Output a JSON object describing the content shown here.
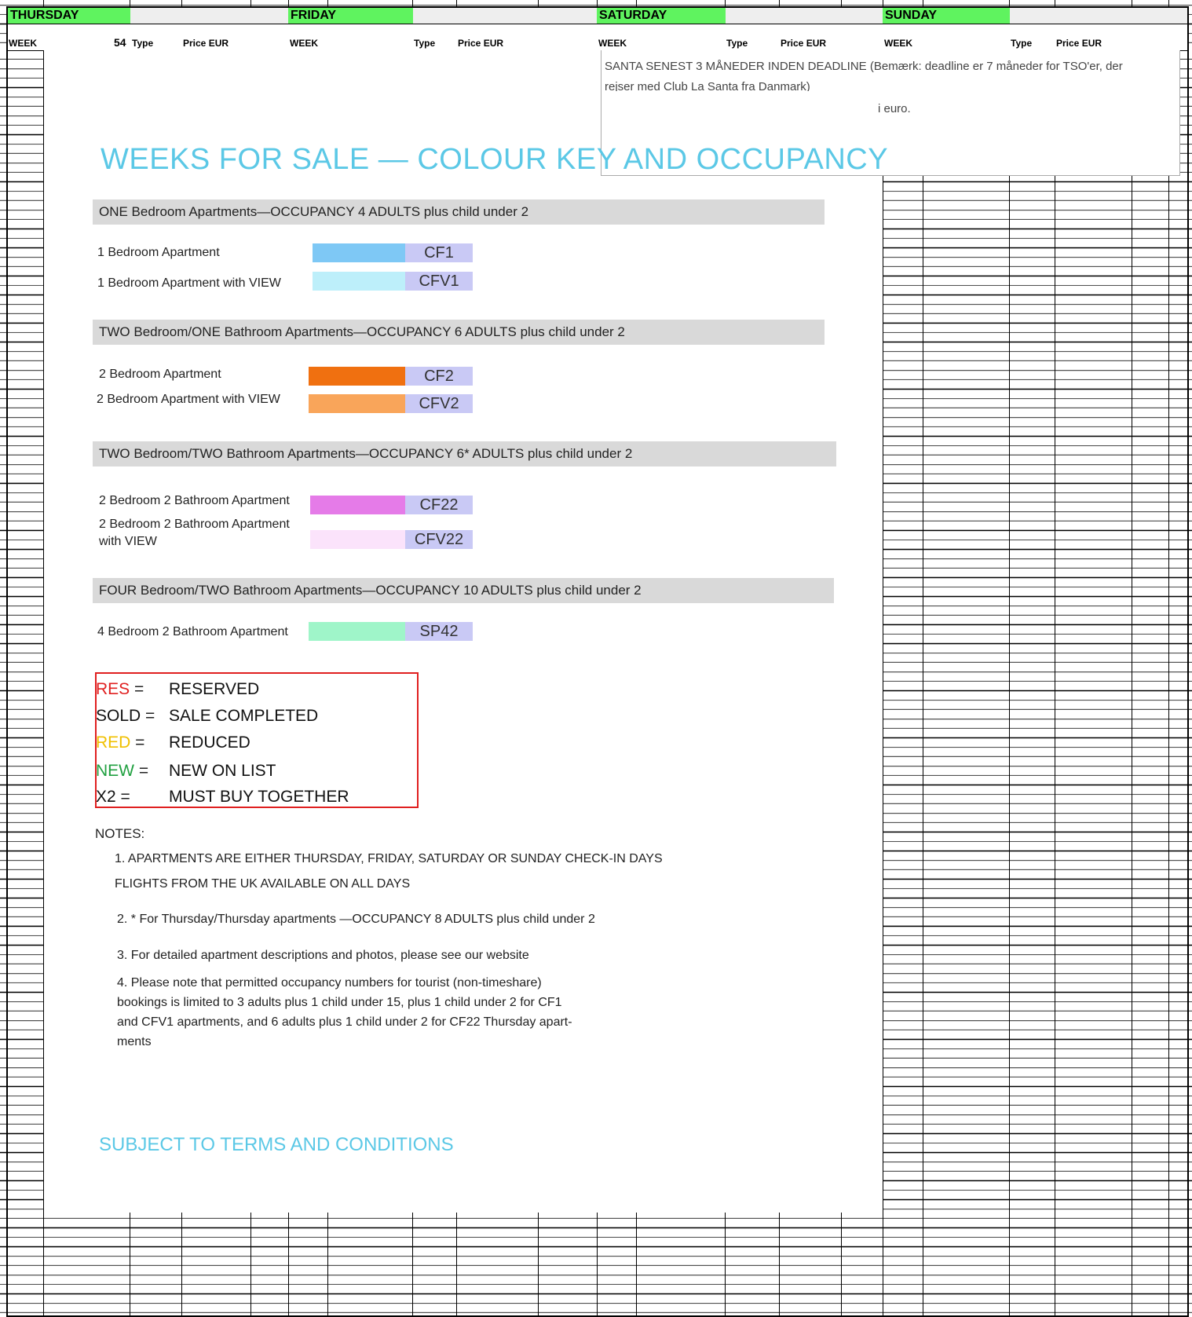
{
  "days": [
    {
      "label": "THURSDAY"
    },
    {
      "label": "FRIDAY"
    },
    {
      "label": "SATURDAY"
    },
    {
      "label": "SUNDAY"
    }
  ],
  "columns": {
    "week": "WEEK",
    "type": "Type",
    "price": "Price EUR",
    "week_no": "54"
  },
  "note_overlay": {
    "line1": "SANTA SENEST 3 MÅNEDER INDEN DEADLINE (Bemærk: deadline er 7 måneder for TSO'er, der",
    "line2": "rejser med Club La Santa fra Danmark)",
    "line3": "i euro."
  },
  "title": "WEEKS FOR SALE — COLOUR KEY AND OCCUPANCY",
  "sections": [
    {
      "heading": "ONE Bedroom Apartments—OCCUPANCY 4 ADULTS plus child under 2",
      "rows": [
        {
          "label": "1 Bedroom Apartment",
          "code": "CF1",
          "color": "#7ec8f5"
        },
        {
          "label": "1 Bedroom Apartment with VIEW",
          "code": "CFV1",
          "color": "#bdeffa"
        }
      ]
    },
    {
      "heading": "TWO Bedroom/ONE Bathroom  Apartments—OCCUPANCY 6 ADULTS plus child under 2",
      "rows": [
        {
          "label": "2 Bedroom Apartment",
          "code": "CF2",
          "color": "#f07010"
        },
        {
          "label": "2 Bedroom Apartment with VIEW",
          "code": "CFV2",
          "color": "#f9a55a"
        }
      ]
    },
    {
      "heading": "TWO Bedroom/TWO Bathroom Apartments—OCCUPANCY 6* ADULTS plus child under 2",
      "rows": [
        {
          "label": "2 Bedroom 2 Bathroom Apartment",
          "code": "CF22",
          "color": "#e57be8"
        },
        {
          "label": "2 Bedroom 2 Bathroom Apartment with VIEW",
          "label_line1": "2 Bedroom 2 Bathroom Apartment",
          "label_line2": "with VIEW",
          "code": "CFV22",
          "color": "#fbe3fb"
        }
      ]
    },
    {
      "heading": "FOUR Bedroom/TWO Bathroom Apartments—OCCUPANCY 10 ADULTS plus child under 2",
      "rows": [
        {
          "label": "4 Bedroom 2 Bathroom Apartment",
          "code": "SP42",
          "color": "#9ff5c9"
        }
      ]
    }
  ],
  "legend": [
    {
      "key": "RES",
      "sep": " =",
      "value": "RESERVED",
      "key_color": "#e02020"
    },
    {
      "key": "SOLD",
      "sep": " =",
      "value": "SALE COMPLETED",
      "key_color": "#111111"
    },
    {
      "key": "RED",
      "sep": " =",
      "value": "REDUCED",
      "key_color": "#f0c000"
    },
    {
      "key": "NEW",
      "sep": " =",
      "value": "NEW ON LIST",
      "key_color": "#20a040"
    },
    {
      "key": "X2",
      "sep": " =",
      "value": "MUST BUY TOGETHER",
      "key_color": "#111111"
    }
  ],
  "notes_heading": "NOTES:",
  "notes": {
    "n1a": "1. APARTMENTS ARE EITHER THURSDAY, FRIDAY, SATURDAY OR SUNDAY CHECK-IN DAYS",
    "n1b": "FLIGHTS FROM THE UK AVAILABLE ON ALL DAYS",
    "n2": "2. * For Thursday/Thursday apartments —OCCUPANCY 8 ADULTS plus child under 2",
    "n3": "3. For detailed apartment descriptions and photos, please see our website",
    "n4a": "4. Please note that permitted occupancy numbers for tourist (non-timeshare)",
    "n4b": "bookings is limited to 3 adults plus 1 child under 15, plus 1 child under 2 for CF1",
    "n4c": "and  CFV1 apartments,  and 6 adults plus 1 child under 2 for CF22 Thursday apart-",
    "n4d": "ments"
  },
  "footer": "SUBJECT TO TERMS AND CONDITIONS"
}
